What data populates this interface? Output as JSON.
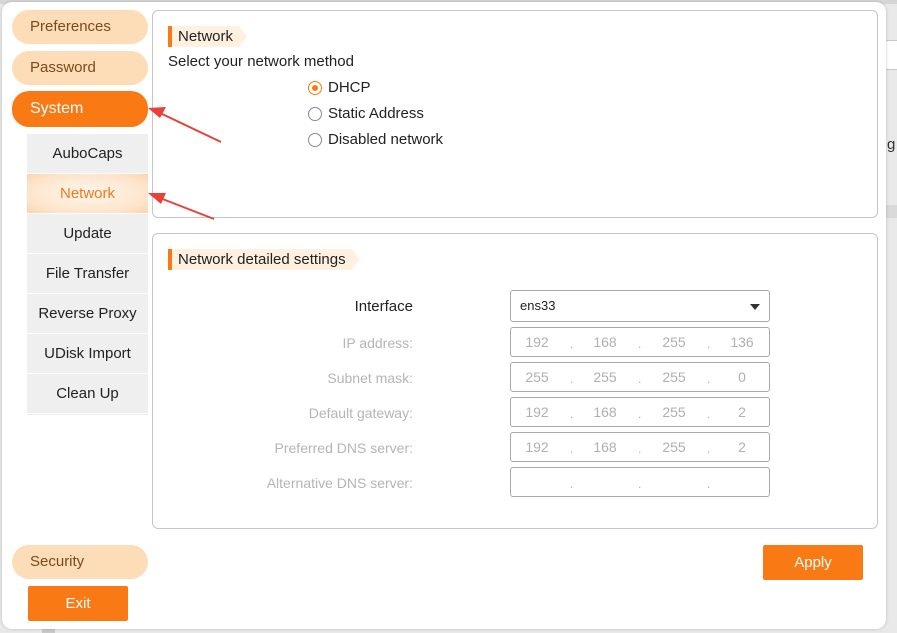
{
  "sidebar": {
    "preferences": "Preferences",
    "password": "Password",
    "system": "System",
    "system_items": [
      {
        "label": "AuboCaps"
      },
      {
        "label": "Network"
      },
      {
        "label": "Update"
      },
      {
        "label": "File Transfer"
      },
      {
        "label": "Reverse Proxy"
      },
      {
        "label": "UDisk Import"
      },
      {
        "label": "Clean Up"
      }
    ],
    "security": "Security",
    "exit": "Exit"
  },
  "network_panel": {
    "title": "Network",
    "prompt": "Select your network method",
    "options": [
      {
        "label": "DHCP",
        "checked": true
      },
      {
        "label": "Static Address",
        "checked": false
      },
      {
        "label": "Disabled network",
        "checked": false
      }
    ]
  },
  "details_panel": {
    "title": "Network detailed settings",
    "interface_label": "Interface",
    "interface_value": "ens33",
    "fields": [
      {
        "label": "IP address:",
        "octets": [
          "192",
          "168",
          "255",
          "136"
        ]
      },
      {
        "label": "Subnet mask:",
        "octets": [
          "255",
          "255",
          "255",
          "0"
        ]
      },
      {
        "label": "Default gateway:",
        "octets": [
          "192",
          "168",
          "255",
          "2"
        ]
      },
      {
        "label": "Preferred DNS server:",
        "octets": [
          "192",
          "168",
          "255",
          "2"
        ]
      },
      {
        "label": "Alternative DNS server:",
        "octets": [
          "",
          "",
          "",
          ""
        ]
      }
    ]
  },
  "apply": "Apply",
  "background": {
    "partial_text": "g"
  },
  "colors": {
    "accent": "#f97a14",
    "accent_light": "#fddcb8",
    "annotation_arrow": "#e8413a"
  }
}
